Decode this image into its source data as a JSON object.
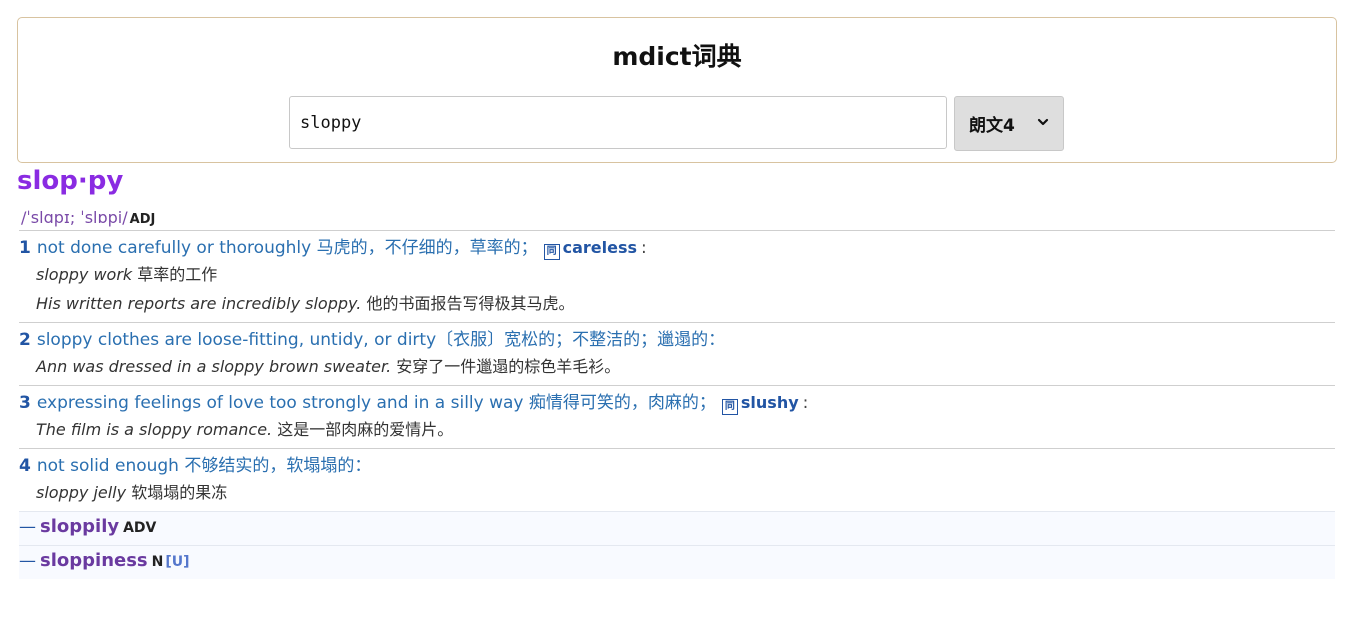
{
  "app": {
    "title": "mdict词典"
  },
  "search": {
    "value": "sloppy",
    "dictionary_selected": "朗文4"
  },
  "entry": {
    "headword": "slop·py",
    "pronunciation": "/ˈslɑpɪ; ˈslɒpi/",
    "pos": "ADJ",
    "senses": [
      {
        "num": "1",
        "definition": "not done carefully or thoroughly 马虎的，不仔细的，草率的；",
        "synonym_icon": "同",
        "synonym": "careless",
        "colon": ":",
        "examples": [
          {
            "en": "sloppy work",
            "zh": "草率的工作"
          },
          {
            "en": "His written reports are incredibly sloppy.",
            "zh": "他的书面报告写得极其马虎。"
          }
        ]
      },
      {
        "num": "2",
        "definition": "sloppy clothes are loose-fitting, untidy, or dirty〔衣服〕宽松的；不整洁的；邋遢的：",
        "examples": [
          {
            "en": "Ann was dressed in a sloppy brown sweater.",
            "zh": "安穿了一件邋遢的棕色羊毛衫。"
          }
        ]
      },
      {
        "num": "3",
        "definition": "expressing feelings of love too strongly and in a silly way 痴情得可笑的，肉麻的；",
        "synonym_icon": "同",
        "synonym": "slushy",
        "colon": ":",
        "examples": [
          {
            "en": "The film is a sloppy romance.",
            "zh": "这是一部肉麻的爱情片。"
          }
        ]
      },
      {
        "num": "4",
        "definition": "not solid enough 不够结实的，软塌塌的：",
        "examples": [
          {
            "en": "sloppy jelly",
            "zh": "软塌塌的果冻"
          }
        ]
      }
    ],
    "derivatives": [
      {
        "dash": "—",
        "word": "sloppily",
        "pos": "ADV",
        "gram": ""
      },
      {
        "dash": "—",
        "word": "sloppiness",
        "pos": "N",
        "gram": "[U]"
      }
    ]
  },
  "icons": {
    "dropdown": "chevron-down-icon",
    "synonym": "synonym-icon"
  }
}
